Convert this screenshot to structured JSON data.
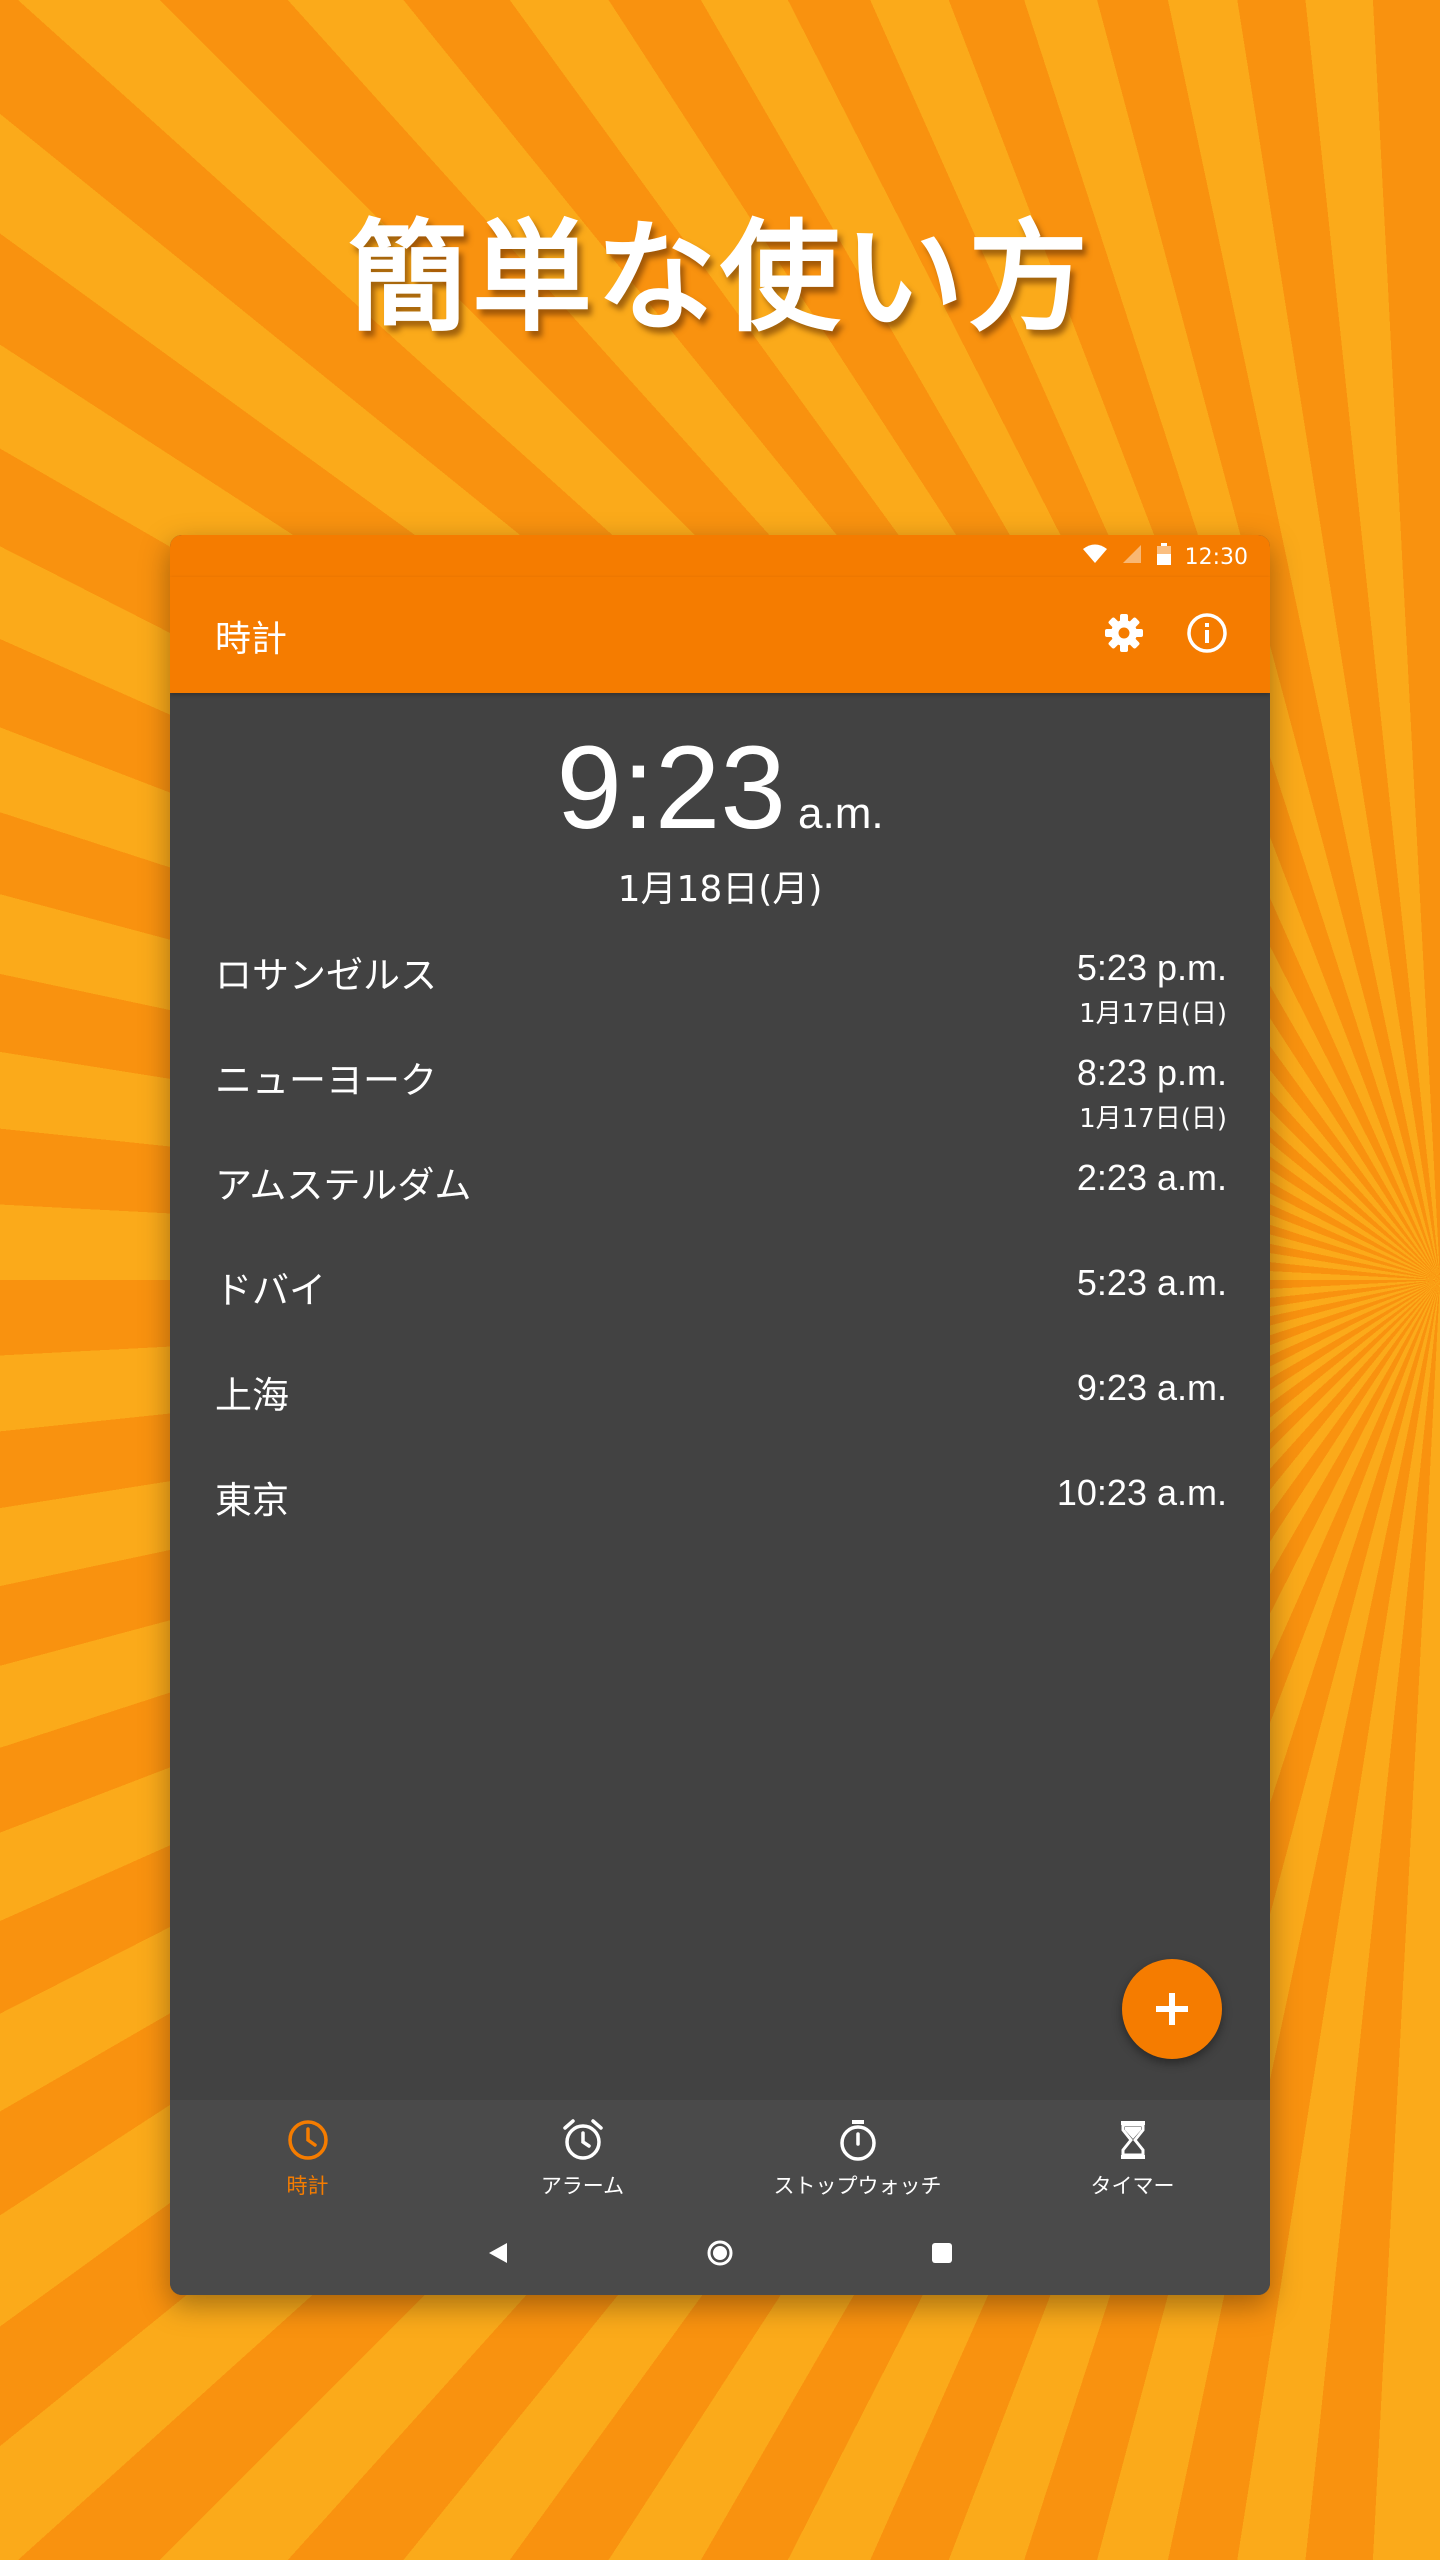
{
  "headline": "簡単な使い方",
  "status_bar": {
    "time": "12:30"
  },
  "app_bar": {
    "title": "時計"
  },
  "clock": {
    "time": "9:23",
    "ampm": "a.m.",
    "date": "1月18日(月)"
  },
  "cities": [
    {
      "name": "ロサンゼルス",
      "time": "5:23 p.m.",
      "date": "1月17日(日)"
    },
    {
      "name": "ニューヨーク",
      "time": "8:23 p.m.",
      "date": "1月17日(日)"
    },
    {
      "name": "アムステルダム",
      "time": "2:23 a.m.",
      "date": ""
    },
    {
      "name": "ドバイ",
      "time": "5:23 a.m.",
      "date": ""
    },
    {
      "name": "上海",
      "time": "9:23 a.m.",
      "date": ""
    },
    {
      "name": "東京",
      "time": "10:23 a.m.",
      "date": ""
    }
  ],
  "bottom_nav": [
    {
      "label": "時計",
      "icon": "clock-icon",
      "active": true
    },
    {
      "label": "アラーム",
      "icon": "alarm-icon",
      "active": false
    },
    {
      "label": "ストップウォッチ",
      "icon": "stopwatch-icon",
      "active": false
    },
    {
      "label": "タイマー",
      "icon": "hourglass-icon",
      "active": false
    }
  ],
  "colors": {
    "accent": "#f57c00",
    "background": "#424242",
    "nav": "#4a4a4a"
  }
}
